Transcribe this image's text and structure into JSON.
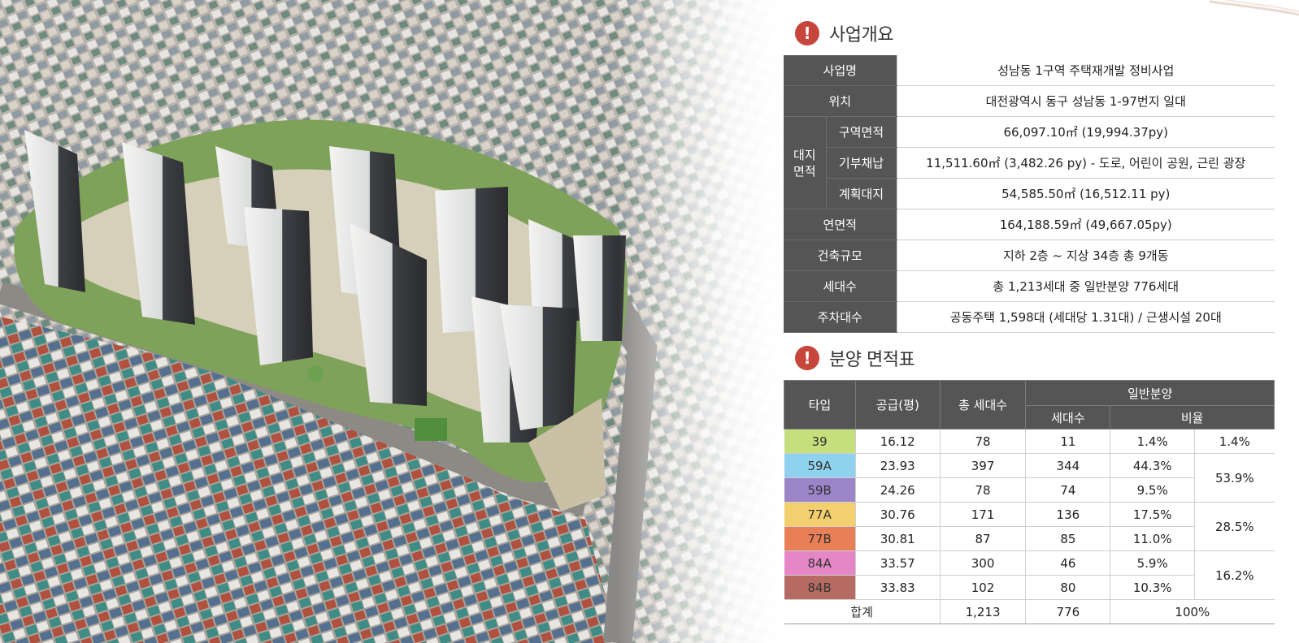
{
  "sections": {
    "overview_title": "사업개요",
    "areas_title": "분양 면적표"
  },
  "overview": {
    "rows": [
      {
        "label": "사업명",
        "value": "성남동 1구역 주택재개발 정비사업"
      },
      {
        "label": "위치",
        "value": "대전광역시 동구 성남동 1-97번지 일대"
      },
      {
        "group": "대지\n면적",
        "label": "구역면적",
        "value": "66,097.10㎡ (19,994.37py)"
      },
      {
        "label": "기부채납",
        "value": "11,511.60㎡ (3,482.26 py) - 도로, 어린이 공원, 근린 광장"
      },
      {
        "label": "계획대지",
        "value": "54,585.50㎡ (16,512.11 py)"
      },
      {
        "label": "연면적",
        "value": "164,188.59㎡ (49,667.05py)"
      },
      {
        "label": "건축규모",
        "value": "지하 2층 ~ 지상 34층 총 9개동"
      },
      {
        "label": "세대수",
        "value": "총 1,213세대 중 일반분양 776세대"
      },
      {
        "label": "주차대수",
        "value": "공동주택 1,598대 (세대당 1.31대) / 근생시설 20대"
      }
    ]
  },
  "areas": {
    "headers": {
      "type": "타입",
      "supply": "공급(평)",
      "total_units": "총 세대수",
      "general": "일반분양",
      "units": "세대수",
      "ratio": "비율"
    },
    "rows": [
      {
        "type": "39",
        "color": "#c5df7c",
        "supply": "16.12",
        "total": "78",
        "units": "11",
        "ratio": "1.4%"
      },
      {
        "type": "59A",
        "color": "#8fd2ee",
        "supply": "23.93",
        "total": "397",
        "units": "344",
        "ratio": "44.3%"
      },
      {
        "type": "59B",
        "color": "#9b84c8",
        "supply": "24.26",
        "total": "78",
        "units": "74",
        "ratio": "9.5%"
      },
      {
        "type": "77A",
        "color": "#f3cf6d",
        "supply": "30.76",
        "total": "171",
        "units": "136",
        "ratio": "17.5%"
      },
      {
        "type": "77B",
        "color": "#e97f57",
        "supply": "30.81",
        "total": "87",
        "units": "85",
        "ratio": "11.0%"
      },
      {
        "type": "84A",
        "color": "#e587c6",
        "supply": "33.57",
        "total": "300",
        "units": "46",
        "ratio": "5.9%"
      },
      {
        "type": "84B",
        "color": "#b56b62",
        "supply": "33.83",
        "total": "102",
        "units": "80",
        "ratio": "10.3%"
      }
    ],
    "group_ratios": [
      "1.4%",
      "53.9%",
      "28.5%",
      "16.2%"
    ],
    "total": {
      "label": "합계",
      "total": "1,213",
      "units": "776",
      "ratio": "100%"
    }
  },
  "colors": {
    "header_bg": "#555555",
    "accent_icon": "#c7463b"
  }
}
